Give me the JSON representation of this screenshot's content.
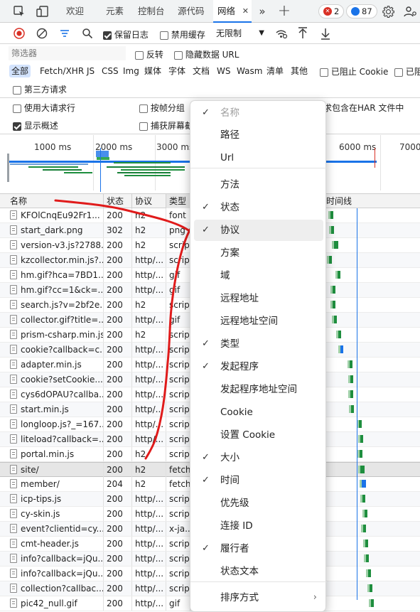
{
  "tabs": [
    "欢迎",
    "元素",
    "控制台",
    "源代码",
    "网络"
  ],
  "badges": {
    "errors": "2",
    "messages": "87"
  },
  "toolbar": {
    "preserve_log": "保留日志",
    "disable_cache": "禁用缓存",
    "throttle": "无限制"
  },
  "filter": {
    "placeholder": "筛选器",
    "invert": "反转",
    "hide_data_url": "隐藏数据 URL"
  },
  "types": [
    "全部",
    "Fetch/XHR",
    "JS",
    "CSS",
    "Img",
    "媒体",
    "字体",
    "文档",
    "WS",
    "Wasm",
    "清单",
    "其他"
  ],
  "blocked_cookies": "已阻止 Cookie",
  "blocked_requests": "已阻",
  "third_party": "第三方请求",
  "settings": {
    "big_rows": "使用大请求行",
    "group_by_frame": "按帧分组",
    "har_tail": "求包含在HAR 文件中",
    "show_overview": "显示概述",
    "capture_screenshots": "捕获屏幕截"
  },
  "overview_ticks": [
    "1000 ms",
    "2000 ms",
    "3000 ms",
    "6000 ms",
    "7000"
  ],
  "columns": {
    "name": "名称",
    "status": "状态",
    "protocol": "协议",
    "type": "类型",
    "waterfall": "时间线"
  },
  "rows": [
    {
      "name": "KFOlCnqEu92Fr1...",
      "status": "200",
      "protocol": "h2",
      "type": "font"
    },
    {
      "name": "start_dark.png",
      "status": "302",
      "protocol": "h2",
      "type": "png"
    },
    {
      "name": "version-v3.js?2788...",
      "status": "200",
      "protocol": "h2",
      "type": "script"
    },
    {
      "name": "kzcollector.min.js?...",
      "status": "200",
      "protocol": "http/...",
      "type": "script"
    },
    {
      "name": "hm.gif?hca=7BD1...",
      "status": "200",
      "protocol": "http/...",
      "type": "gif"
    },
    {
      "name": "hm.gif?cc=1&ck=...",
      "status": "200",
      "protocol": "http/...",
      "type": "gif"
    },
    {
      "name": "search.js?v=2bf2e...",
      "status": "200",
      "protocol": "h2",
      "type": "script"
    },
    {
      "name": "collector.gif?title=...",
      "status": "200",
      "protocol": "http/...",
      "type": "gif"
    },
    {
      "name": "prism-csharp.min.js",
      "status": "200",
      "protocol": "h2",
      "type": "script"
    },
    {
      "name": "cookie?callback=c...",
      "status": "200",
      "protocol": "http/...",
      "type": "script"
    },
    {
      "name": "adapter.min.js",
      "status": "200",
      "protocol": "http/...",
      "type": "script"
    },
    {
      "name": "cookie?setCookie...",
      "status": "200",
      "protocol": "http/...",
      "type": "script"
    },
    {
      "name": "cys6dOPAU?callba...",
      "status": "200",
      "protocol": "http/...",
      "type": "script"
    },
    {
      "name": "start.min.js",
      "status": "200",
      "protocol": "http/...",
      "type": "script"
    },
    {
      "name": "longloop.js?_=167...",
      "status": "200",
      "protocol": "http/...",
      "type": "script"
    },
    {
      "name": "liteload?callback=...",
      "status": "200",
      "protocol": "http/...",
      "type": "script"
    },
    {
      "name": "portal.min.js",
      "status": "200",
      "protocol": "h2",
      "type": "script"
    },
    {
      "name": "site/",
      "status": "200",
      "protocol": "h2",
      "type": "fetch"
    },
    {
      "name": "member/",
      "status": "204",
      "protocol": "h2",
      "type": "fetch"
    },
    {
      "name": "icp-tips.js",
      "status": "200",
      "protocol": "http/...",
      "type": "script"
    },
    {
      "name": "cy-skin.js",
      "status": "200",
      "protocol": "http/...",
      "type": "script"
    },
    {
      "name": "event?clientid=cy...",
      "status": "200",
      "protocol": "http/...",
      "type": "x-ja..."
    },
    {
      "name": "cmt-header.js",
      "status": "200",
      "protocol": "http/...",
      "type": "script"
    },
    {
      "name": "info?callback=jQu...",
      "status": "200",
      "protocol": "http/...",
      "type": "script"
    },
    {
      "name": "info?callback=jQu...",
      "status": "200",
      "protocol": "http/...",
      "type": "script"
    },
    {
      "name": "collection?callbac...",
      "status": "200",
      "protocol": "http/...",
      "type": "script"
    },
    {
      "name": "pic42_null.gif",
      "status": "200",
      "protocol": "http/...",
      "type": "gif"
    }
  ],
  "menu": [
    {
      "label": "名称",
      "checked": true,
      "disabled": true
    },
    {
      "label": "路径",
      "checked": false
    },
    {
      "label": "Url",
      "checked": false
    },
    {
      "label": "方法",
      "checked": false
    },
    {
      "label": "状态",
      "checked": true
    },
    {
      "label": "协议",
      "checked": true
    },
    {
      "label": "方案",
      "checked": false
    },
    {
      "label": "域",
      "checked": false
    },
    {
      "label": "远程地址",
      "checked": false
    },
    {
      "label": "远程地址空间",
      "checked": false
    },
    {
      "label": "类型",
      "checked": true
    },
    {
      "label": "发起程序",
      "checked": true
    },
    {
      "label": "发起程序地址空间",
      "checked": false
    },
    {
      "label": "Cookie",
      "checked": false
    },
    {
      "label": "设置 Cookie",
      "checked": false
    },
    {
      "label": "大小",
      "checked": true
    },
    {
      "label": "时间",
      "checked": true
    },
    {
      "label": "优先级",
      "checked": false
    },
    {
      "label": "连接 ID",
      "checked": false
    },
    {
      "label": "履行者",
      "checked": true
    },
    {
      "label": "状态文本",
      "checked": false
    },
    {
      "label": "排序方式",
      "checked": false
    }
  ],
  "waterfall_pct": [
    0.5,
    0.6,
    0.9,
    0.4,
    1.3,
    0.8,
    0.8,
    0.9,
    1.4,
    1.6,
    2.6,
    2.7,
    2.7,
    2.8,
    3.6,
    3.8,
    3.7,
    3.8,
    3.9,
    4.0,
    4.2,
    4.1,
    4.3,
    4.4,
    4.6,
    4.8,
    4.9
  ]
}
